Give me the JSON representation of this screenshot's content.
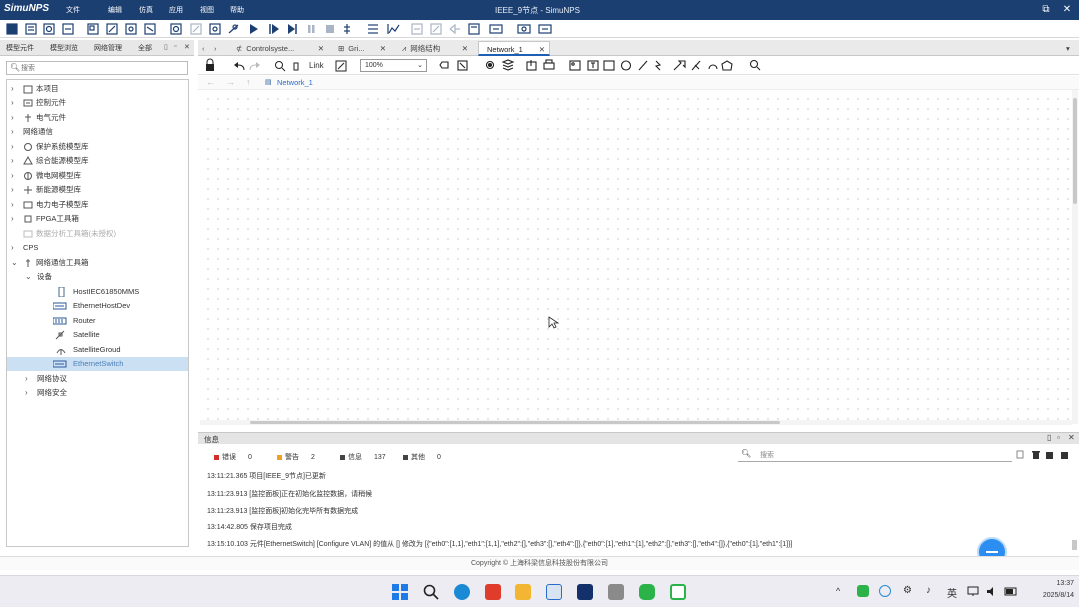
{
  "app": {
    "logo": "SimuNPS",
    "window_title": "IEEE_9节点 - SimuNPS",
    "menu": [
      "文件",
      "编辑",
      "仿真",
      "应用",
      "视图",
      "帮助"
    ]
  },
  "left_panel": {
    "tabs": [
      "模型元件",
      "模型浏览",
      "网络管理",
      "全部"
    ],
    "search_placeholder": "搜索",
    "tree": [
      {
        "label": "本项目",
        "arrow": "›"
      },
      {
        "label": "控制元件",
        "arrow": "›"
      },
      {
        "label": "电气元件",
        "arrow": "›"
      },
      {
        "label": "网络通信",
        "arrow": "›"
      },
      {
        "label": "保护系统模型库",
        "arrow": "›"
      },
      {
        "label": "综合能源模型库",
        "arrow": "›"
      },
      {
        "label": "微电网模型库",
        "arrow": "›"
      },
      {
        "label": "新能源模型库",
        "arrow": "›"
      },
      {
        "label": "电力电子模型库",
        "arrow": "›"
      },
      {
        "label": "FPGA工具箱",
        "arrow": "›"
      },
      {
        "label": "数据分析工具箱(未授权)",
        "arrow": ""
      },
      {
        "label": "CPS",
        "arrow": "›"
      },
      {
        "label": "网络通信工具箱",
        "arrow": "⌄"
      },
      {
        "label": "设备",
        "arrow": "⌄"
      },
      {
        "label": "HostIEC61850MMS",
        "arrow": ""
      },
      {
        "label": "EthernetHostDev",
        "arrow": ""
      },
      {
        "label": "Router",
        "arrow": ""
      },
      {
        "label": "Satellite",
        "arrow": ""
      },
      {
        "label": "SatelliteGroud",
        "arrow": ""
      },
      {
        "label": "EthernetSwitch",
        "arrow": ""
      },
      {
        "label": "网络协议",
        "arrow": "›"
      },
      {
        "label": "网络安全",
        "arrow": "›"
      }
    ]
  },
  "editor": {
    "tabs": [
      "Controlsyste...",
      "Gri...",
      "网络结构",
      "Network_1"
    ],
    "active_tab": "Network_1",
    "zoom": "100%",
    "link_label": "Link",
    "breadcrumb": "Network_1"
  },
  "info_panel": {
    "title": "信息",
    "counts": [
      {
        "label": "错误",
        "value": "0",
        "color": "#d62b2b"
      },
      {
        "label": "警告",
        "value": "2",
        "color": "#f0a020"
      },
      {
        "label": "信息",
        "value": "137",
        "color": "#444444"
      },
      {
        "label": "其他",
        "value": "0",
        "color": "#444444"
      }
    ],
    "search_placeholder": "搜索",
    "logs": [
      "13:11:21.365 项目[IEEE_9节点]已更新",
      "13:11:23.913 [监控面板]正在初始化监控数据，请稍候",
      "13:11:23.913 [监控面板]初始化完毕所有数据完成",
      "13:14:42.805 保存项目完成",
      "13:15:10.103 元件[EthernetSwitch] [Configure VLAN] 的值从 [] 修改为 [{\"eth0\":[1,1],\"eth1\":[1,1],\"eth2\":[],\"eth3\":[],\"eth4\":[]},{\"eth0\":[1],\"eth1\":[1],\"eth2\":[],\"eth3\":[],\"eth4\":[]},{\"eth0\":[1],\"eth1\":[1]}]"
    ]
  },
  "status": {
    "copyright": "Copyright © 上海科梁信息科技股份有限公司"
  },
  "taskbar": {
    "ime": "英",
    "time": "13:37",
    "date": "2025/8/14"
  },
  "colors": {
    "titlebar": "#1c3f72",
    "accent": "#1f5fb3",
    "selection": "#cce0f4"
  }
}
